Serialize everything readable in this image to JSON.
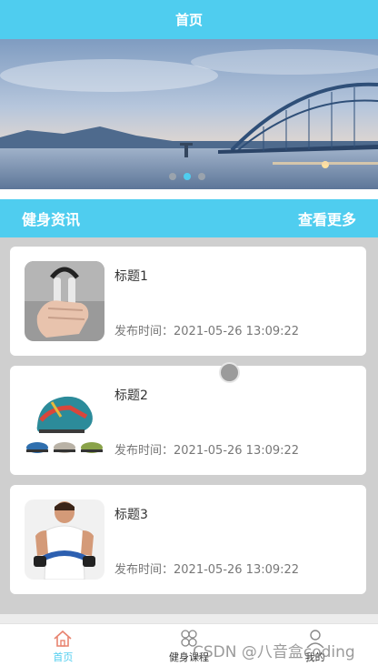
{
  "header": {
    "title": "首页"
  },
  "banner": {
    "dot_count": 3,
    "active_index": 1
  },
  "section": {
    "title": "健身资讯",
    "more": "查看更多"
  },
  "articles": [
    {
      "title": "标题1",
      "time": "发布时间：2021-05-26 13:09:22",
      "image": "hand-gripper-image"
    },
    {
      "title": "标题2",
      "time": "发布时间：2021-05-26 13:09:22",
      "image": "basketball-shoes-image"
    },
    {
      "title": "标题3",
      "time": "发布时间：2021-05-26 13:09:22",
      "image": "chest-expander-man-image"
    }
  ],
  "tabbar": {
    "items": [
      {
        "label": "首页",
        "icon": "home-icon",
        "active": true
      },
      {
        "label": "健身课程",
        "icon": "course-icon",
        "active": false
      },
      {
        "label": "我的",
        "icon": "user-icon",
        "active": false
      }
    ]
  },
  "watermark": "CSDN @八音盒coding",
  "colors": {
    "accent": "#4fcdef",
    "list_bg": "#cfcfcf",
    "text": "#333333",
    "muted": "#777777"
  }
}
